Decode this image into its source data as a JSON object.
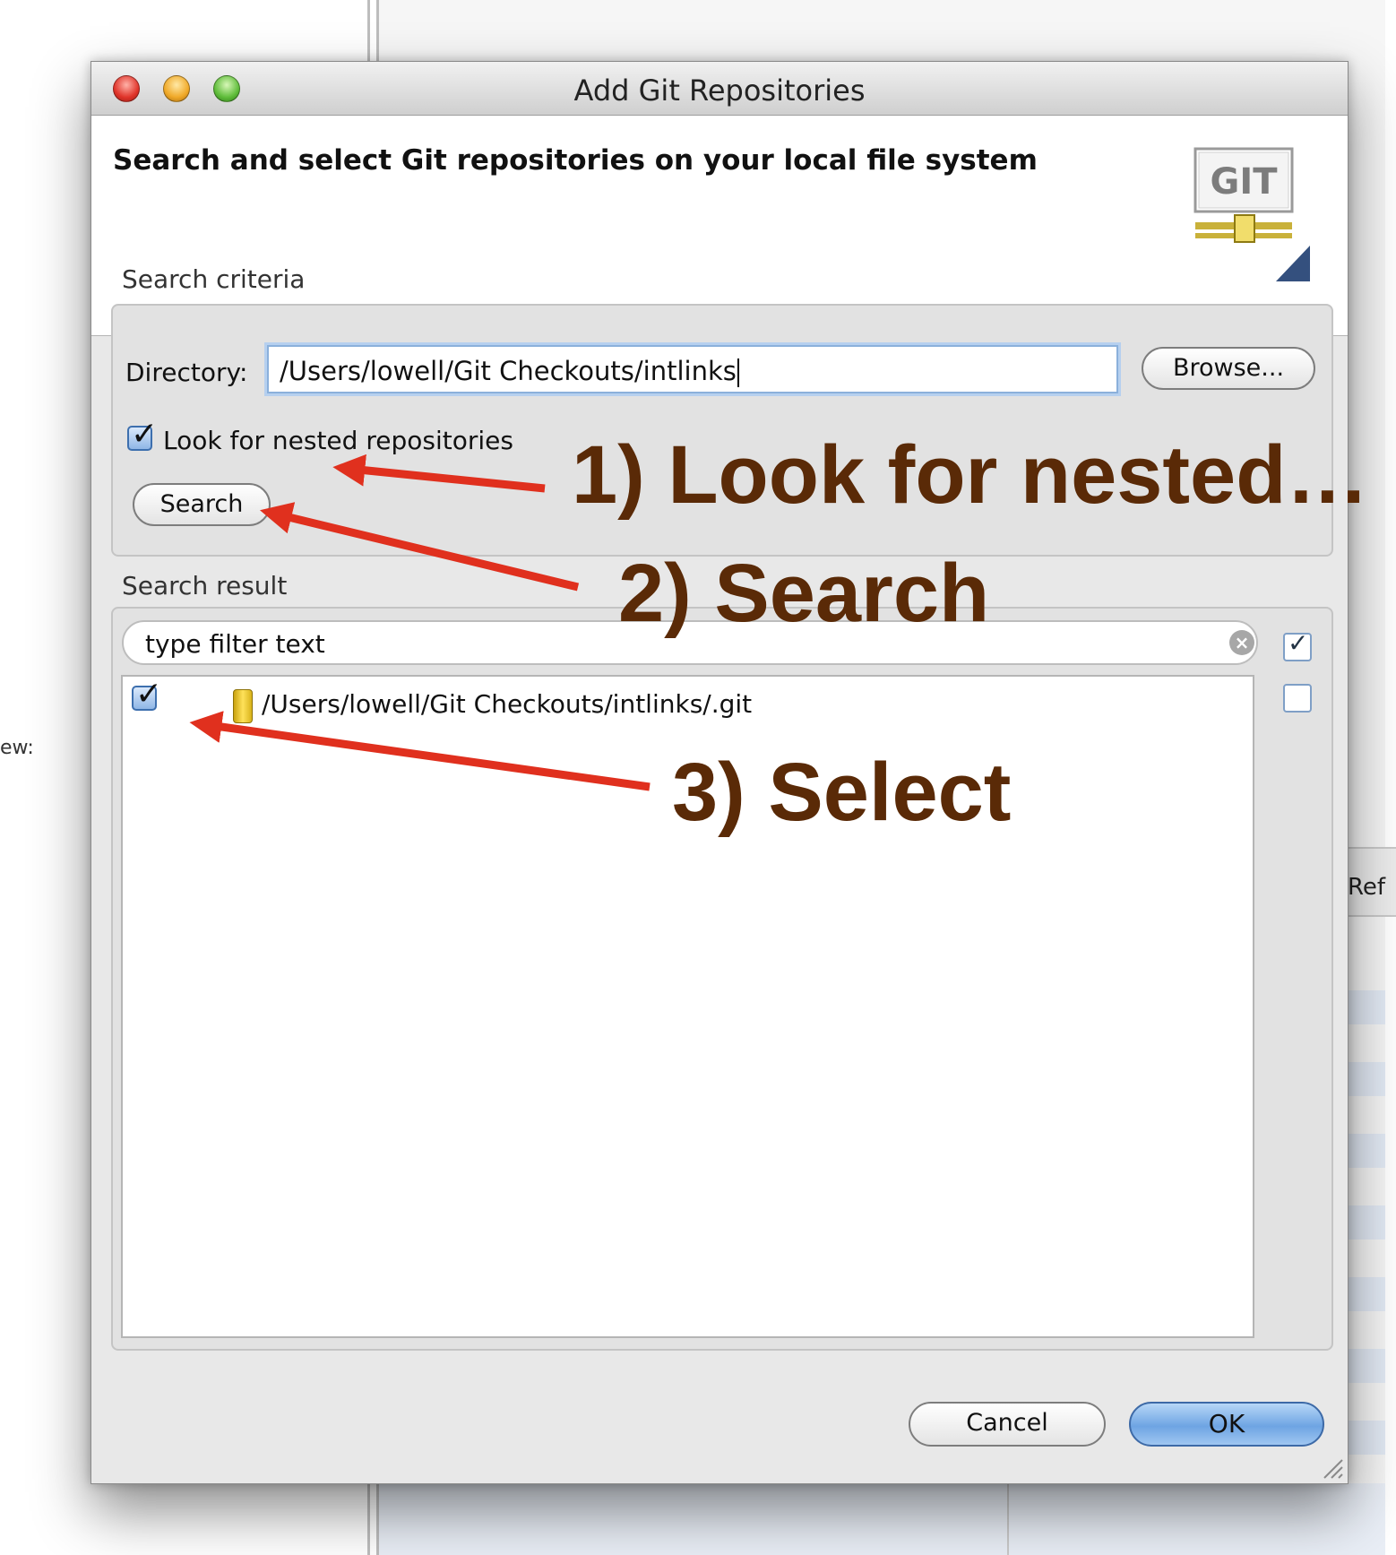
{
  "background": {
    "left_label": "ew:",
    "right_header_label": "Ref"
  },
  "dialog": {
    "title": "Add Git Repositories",
    "header_text": "Search and select Git repositories on your local file system",
    "logo_text": "GIT",
    "search_criteria": {
      "group_label": "Search criteria",
      "directory_label": "Directory:",
      "directory_value": "/Users/lowell/Git Checkouts/intlinks",
      "browse_label": "Browse...",
      "nested_label": "Look for nested repositories",
      "nested_checked": true,
      "search_label": "Search"
    },
    "search_result": {
      "group_label": "Search result",
      "filter_placeholder": "type filter text",
      "items": [
        {
          "path": "/Users/lowell/Git Checkouts/intlinks/.git",
          "checked": true
        }
      ]
    },
    "buttons": {
      "cancel": "Cancel",
      "ok": "OK"
    }
  },
  "annotations": {
    "step1": "1) Look for nested…",
    "step2": "2) Search",
    "step3": "3) Select",
    "color": "#5a2a07",
    "arrow_color": "#e0301e"
  }
}
